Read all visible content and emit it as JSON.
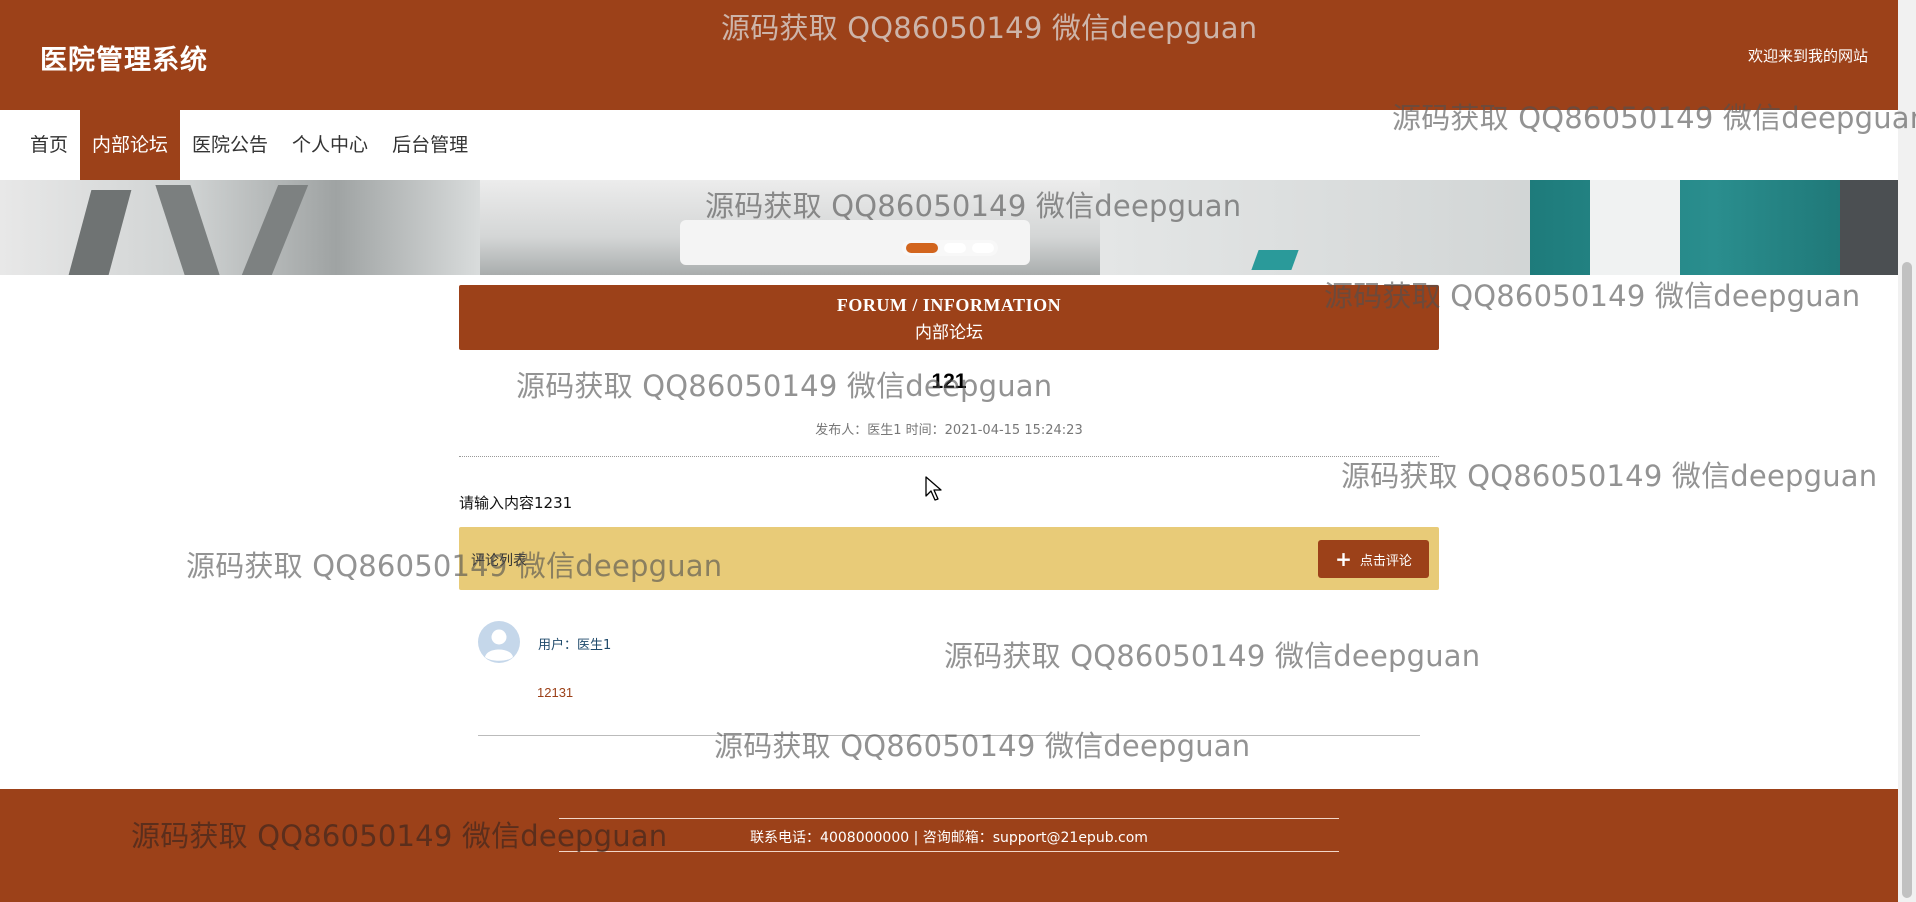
{
  "header": {
    "site_title": "医院管理系统",
    "welcome": "欢迎来到我的网站"
  },
  "nav": {
    "items": [
      {
        "label": "首页",
        "active": false
      },
      {
        "label": "内部论坛",
        "active": true
      },
      {
        "label": "医院公告",
        "active": false
      },
      {
        "label": "个人中心",
        "active": false
      },
      {
        "label": "后台管理",
        "active": false
      }
    ]
  },
  "banner": {
    "slides": 3,
    "active_slide": 1
  },
  "section": {
    "title_en": "FORUM / INFORMATION",
    "title_cn": "内部论坛"
  },
  "post": {
    "title": "121",
    "meta": "发布人：医生1 时间：2021-04-15 15:24:23",
    "content": "请输入内容1231"
  },
  "comments": {
    "header": "评论列表",
    "add_label": "点击评论",
    "items": [
      {
        "user": "用户：医生1",
        "text": "12131"
      }
    ]
  },
  "footer": {
    "contact": "联系电话：4008000000 | 咨询邮箱：support@21epub.com"
  },
  "watermark": {
    "text": "源码获取 QQ86050149 微信deepguan"
  },
  "colors": {
    "brand": "#9c4119",
    "comment_bar": "#e8cb78",
    "active_dot": "#d2651e"
  },
  "icons": {
    "add_comment": "plus-icon",
    "avatar": "user-avatar-icon",
    "cursor": "mouse-cursor-icon"
  }
}
